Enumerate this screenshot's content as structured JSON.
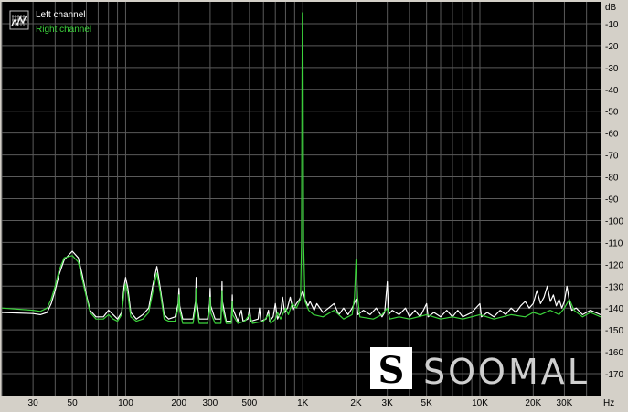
{
  "chart_data": {
    "type": "line",
    "title": "",
    "xlabel": "",
    "ylabel": "",
    "x_unit": "Hz",
    "y_unit": "dB",
    "x_scale": "log",
    "xlim": [
      20,
      48000
    ],
    "ylim": [
      -180,
      0
    ],
    "grid": true,
    "legend_position": "top-left",
    "x_ticks": [
      {
        "value": 30,
        "label": "30"
      },
      {
        "value": 50,
        "label": "50"
      },
      {
        "value": 100,
        "label": "100"
      },
      {
        "value": 200,
        "label": "200"
      },
      {
        "value": 300,
        "label": "300"
      },
      {
        "value": 500,
        "label": "500"
      },
      {
        "value": 1000,
        "label": "1K"
      },
      {
        "value": 2000,
        "label": "2K"
      },
      {
        "value": 3000,
        "label": "3K"
      },
      {
        "value": 5000,
        "label": "5K"
      },
      {
        "value": 10000,
        "label": "10K"
      },
      {
        "value": 20000,
        "label": "20K"
      },
      {
        "value": 30000,
        "label": "30K"
      }
    ],
    "y_ticks": [
      {
        "value": -10,
        "label": "-10"
      },
      {
        "value": -20,
        "label": "-20"
      },
      {
        "value": -30,
        "label": "-30"
      },
      {
        "value": -40,
        "label": "-40"
      },
      {
        "value": -50,
        "label": "-50"
      },
      {
        "value": -60,
        "label": "-60"
      },
      {
        "value": -70,
        "label": "-70"
      },
      {
        "value": -80,
        "label": "-80"
      },
      {
        "value": -90,
        "label": "-90"
      },
      {
        "value": -100,
        "label": "-100"
      },
      {
        "value": -110,
        "label": "-110"
      },
      {
        "value": -120,
        "label": "-120"
      },
      {
        "value": -130,
        "label": "-130"
      },
      {
        "value": -140,
        "label": "-140"
      },
      {
        "value": -150,
        "label": "-150"
      },
      {
        "value": -160,
        "label": "-160"
      },
      {
        "value": -170,
        "label": "-170"
      }
    ],
    "series": [
      {
        "name": "Left channel",
        "color": "#ffffff",
        "points": [
          [
            20,
            -142
          ],
          [
            30,
            -142.5
          ],
          [
            33,
            -143
          ],
          [
            36,
            -142
          ],
          [
            38,
            -138
          ],
          [
            40,
            -132
          ],
          [
            42,
            -125
          ],
          [
            45,
            -118
          ],
          [
            50,
            -114
          ],
          [
            54,
            -117
          ],
          [
            57,
            -125
          ],
          [
            60,
            -134
          ],
          [
            63,
            -141
          ],
          [
            68,
            -144
          ],
          [
            75,
            -144
          ],
          [
            80,
            -141
          ],
          [
            85,
            -143
          ],
          [
            90,
            -145
          ],
          [
            95,
            -142
          ],
          [
            98,
            -130
          ],
          [
            100,
            -126
          ],
          [
            103,
            -131
          ],
          [
            107,
            -142
          ],
          [
            115,
            -145
          ],
          [
            125,
            -143
          ],
          [
            135,
            -140
          ],
          [
            142,
            -130
          ],
          [
            150,
            -121
          ],
          [
            157,
            -131
          ],
          [
            165,
            -143
          ],
          [
            175,
            -145
          ],
          [
            190,
            -144
          ],
          [
            198,
            -138
          ],
          [
            200,
            -131
          ],
          [
            202,
            -139
          ],
          [
            210,
            -145
          ],
          [
            240,
            -145
          ],
          [
            248,
            -137
          ],
          [
            250,
            -126
          ],
          [
            252,
            -137
          ],
          [
            260,
            -145
          ],
          [
            290,
            -145
          ],
          [
            298,
            -138
          ],
          [
            300,
            -131
          ],
          [
            302,
            -139
          ],
          [
            320,
            -145
          ],
          [
            345,
            -145
          ],
          [
            348,
            -137
          ],
          [
            350,
            -128
          ],
          [
            352,
            -137
          ],
          [
            370,
            -146
          ],
          [
            395,
            -146
          ],
          [
            398,
            -139
          ],
          [
            400,
            -134
          ],
          [
            402,
            -140
          ],
          [
            430,
            -146
          ],
          [
            450,
            -141
          ],
          [
            460,
            -146
          ],
          [
            490,
            -145
          ],
          [
            500,
            -140
          ],
          [
            510,
            -146
          ],
          [
            560,
            -145
          ],
          [
            570,
            -140
          ],
          [
            580,
            -146
          ],
          [
            620,
            -145
          ],
          [
            640,
            -141
          ],
          [
            650,
            -146
          ],
          [
            680,
            -144
          ],
          [
            700,
            -138
          ],
          [
            720,
            -145
          ],
          [
            750,
            -142
          ],
          [
            770,
            -135
          ],
          [
            790,
            -142
          ],
          [
            820,
            -140
          ],
          [
            850,
            -135
          ],
          [
            880,
            -141
          ],
          [
            920,
            -138
          ],
          [
            960,
            -136
          ],
          [
            990,
            -133
          ],
          [
            1000,
            -132
          ],
          [
            1030,
            -136
          ],
          [
            1070,
            -139
          ],
          [
            1100,
            -137
          ],
          [
            1160,
            -141
          ],
          [
            1200,
            -138
          ],
          [
            1300,
            -142
          ],
          [
            1400,
            -140
          ],
          [
            1500,
            -138
          ],
          [
            1600,
            -143
          ],
          [
            1700,
            -140
          ],
          [
            1800,
            -143
          ],
          [
            1900,
            -140
          ],
          [
            2000,
            -136
          ],
          [
            2050,
            -143
          ],
          [
            2200,
            -141
          ],
          [
            2400,
            -143
          ],
          [
            2600,
            -140
          ],
          [
            2800,
            -144
          ],
          [
            2900,
            -142
          ],
          [
            3000,
            -128
          ],
          [
            3050,
            -143
          ],
          [
            3200,
            -141
          ],
          [
            3500,
            -143
          ],
          [
            3800,
            -140
          ],
          [
            4000,
            -144
          ],
          [
            4300,
            -141
          ],
          [
            4600,
            -144
          ],
          [
            5000,
            -138
          ],
          [
            5100,
            -144
          ],
          [
            5500,
            -142
          ],
          [
            6000,
            -144
          ],
          [
            6500,
            -141
          ],
          [
            7000,
            -144
          ],
          [
            7500,
            -141
          ],
          [
            8000,
            -144
          ],
          [
            9000,
            -142
          ],
          [
            10000,
            -138
          ],
          [
            10200,
            -144
          ],
          [
            11000,
            -142
          ],
          [
            12000,
            -144
          ],
          [
            13000,
            -141
          ],
          [
            14000,
            -143
          ],
          [
            15000,
            -140
          ],
          [
            16000,
            -142
          ],
          [
            17000,
            -139
          ],
          [
            18000,
            -137
          ],
          [
            19000,
            -140
          ],
          [
            20000,
            -138
          ],
          [
            21000,
            -132
          ],
          [
            22000,
            -138
          ],
          [
            23000,
            -135
          ],
          [
            24000,
            -130
          ],
          [
            25000,
            -137
          ],
          [
            26000,
            -134
          ],
          [
            27000,
            -139
          ],
          [
            28000,
            -136
          ],
          [
            29000,
            -140
          ],
          [
            30000,
            -137
          ],
          [
            31000,
            -130
          ],
          [
            32000,
            -137
          ],
          [
            33000,
            -141
          ],
          [
            35000,
            -140
          ],
          [
            38000,
            -143
          ],
          [
            42000,
            -141
          ],
          [
            48000,
            -143
          ]
        ]
      },
      {
        "name": "Right channel",
        "color": "#3cd23c",
        "points": [
          [
            20,
            -140
          ],
          [
            30,
            -141
          ],
          [
            33,
            -141.5
          ],
          [
            36,
            -140
          ],
          [
            38,
            -136
          ],
          [
            40,
            -130
          ],
          [
            42,
            -123
          ],
          [
            45,
            -117
          ],
          [
            50,
            -116
          ],
          [
            54,
            -119
          ],
          [
            57,
            -127
          ],
          [
            60,
            -135
          ],
          [
            63,
            -142
          ],
          [
            68,
            -145
          ],
          [
            75,
            -145
          ],
          [
            80,
            -143
          ],
          [
            85,
            -145
          ],
          [
            90,
            -146
          ],
          [
            95,
            -143
          ],
          [
            98,
            -133
          ],
          [
            100,
            -129
          ],
          [
            103,
            -134
          ],
          [
            107,
            -144
          ],
          [
            115,
            -146
          ],
          [
            125,
            -145
          ],
          [
            135,
            -142
          ],
          [
            142,
            -133
          ],
          [
            150,
            -124
          ],
          [
            157,
            -133
          ],
          [
            165,
            -145
          ],
          [
            175,
            -146
          ],
          [
            190,
            -146
          ],
          [
            198,
            -140
          ],
          [
            200,
            -134
          ],
          [
            202,
            -141
          ],
          [
            210,
            -147
          ],
          [
            240,
            -147
          ],
          [
            248,
            -140
          ],
          [
            250,
            -131
          ],
          [
            252,
            -140
          ],
          [
            260,
            -147
          ],
          [
            290,
            -147
          ],
          [
            298,
            -141
          ],
          [
            300,
            -135
          ],
          [
            302,
            -142
          ],
          [
            320,
            -147
          ],
          [
            345,
            -147
          ],
          [
            348,
            -140
          ],
          [
            350,
            -132
          ],
          [
            352,
            -140
          ],
          [
            370,
            -147
          ],
          [
            395,
            -147
          ],
          [
            398,
            -142
          ],
          [
            400,
            -137
          ],
          [
            402,
            -143
          ],
          [
            430,
            -147
          ],
          [
            470,
            -146
          ],
          [
            500,
            -143
          ],
          [
            520,
            -147
          ],
          [
            600,
            -146
          ],
          [
            640,
            -143
          ],
          [
            660,
            -147
          ],
          [
            700,
            -145
          ],
          [
            720,
            -142
          ],
          [
            750,
            -145
          ],
          [
            800,
            -140
          ],
          [
            830,
            -143
          ],
          [
            870,
            -138
          ],
          [
            920,
            -140
          ],
          [
            970,
            -136
          ],
          [
            985,
            -110
          ],
          [
            990,
            -40
          ],
          [
            995,
            -5
          ],
          [
            1000,
            -5
          ],
          [
            1005,
            -40
          ],
          [
            1010,
            -110
          ],
          [
            1030,
            -137
          ],
          [
            1080,
            -141
          ],
          [
            1150,
            -143
          ],
          [
            1300,
            -144
          ],
          [
            1500,
            -141
          ],
          [
            1700,
            -145
          ],
          [
            1900,
            -143
          ],
          [
            1960,
            -135
          ],
          [
            2000,
            -118
          ],
          [
            2040,
            -135
          ],
          [
            2100,
            -144
          ],
          [
            2500,
            -145
          ],
          [
            2800,
            -143
          ],
          [
            3000,
            -140
          ],
          [
            3100,
            -145
          ],
          [
            3500,
            -144
          ],
          [
            4000,
            -145
          ],
          [
            5000,
            -143
          ],
          [
            6000,
            -145
          ],
          [
            7000,
            -144
          ],
          [
            8000,
            -145
          ],
          [
            10000,
            -143
          ],
          [
            12000,
            -145
          ],
          [
            15000,
            -143
          ],
          [
            18000,
            -144
          ],
          [
            20000,
            -142
          ],
          [
            22000,
            -143
          ],
          [
            25000,
            -141
          ],
          [
            28000,
            -143
          ],
          [
            30000,
            -140
          ],
          [
            32000,
            -136
          ],
          [
            34000,
            -141
          ],
          [
            38000,
            -144
          ],
          [
            42000,
            -142
          ],
          [
            48000,
            -144
          ]
        ]
      }
    ]
  },
  "legend": {
    "left_label": "Left channel",
    "right_label": "Right channel"
  },
  "watermark": {
    "text": "SOOMAL",
    "logo_letter": "S"
  },
  "colors": {
    "plot_background": "#000000",
    "frame": "#d4d0c8",
    "grid": "#5a5a5a",
    "left_channel": "#ffffff",
    "right_channel": "#3cd23c",
    "watermark": "#cfcfcf"
  }
}
